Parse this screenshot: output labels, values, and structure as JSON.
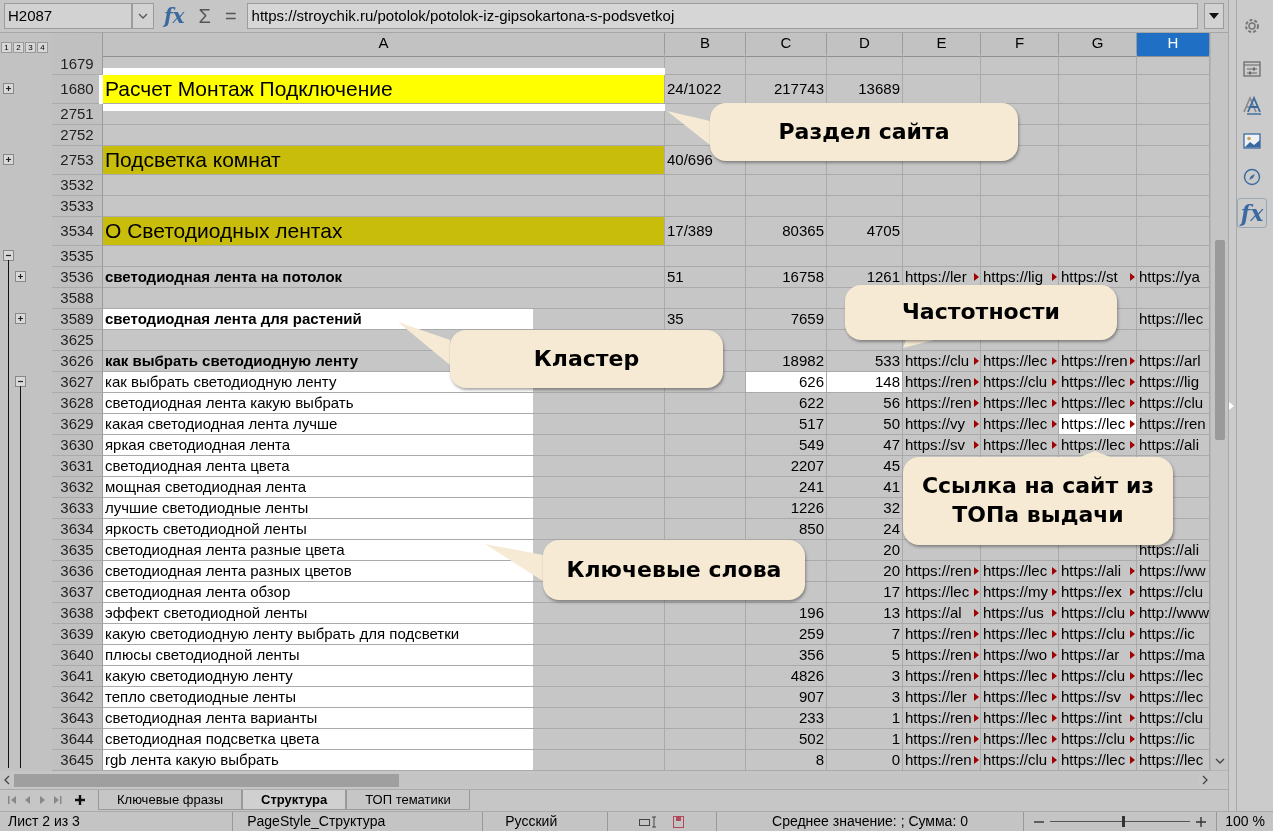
{
  "formula_bar": {
    "cell_ref": "H2087",
    "buttons": [
      {
        "kind": "function",
        "label": "fx"
      },
      {
        "kind": "sum",
        "label": "Σ"
      },
      {
        "kind": "formula",
        "label": "="
      }
    ],
    "content": "https://stroychik.ru/potolok/potolok-iz-gipsokartona-s-podsvetkoj"
  },
  "outline_levels": [
    "1",
    "2",
    "3",
    "4"
  ],
  "columns": [
    {
      "label": "A",
      "selected": false
    },
    {
      "label": "B",
      "selected": false
    },
    {
      "label": "C",
      "selected": false
    },
    {
      "label": "D",
      "selected": false
    },
    {
      "label": "E",
      "selected": false
    },
    {
      "label": "F",
      "selected": false
    },
    {
      "label": "G",
      "selected": false
    },
    {
      "label": "H",
      "selected": true
    }
  ],
  "rows": [
    {
      "number": "1679",
      "kind": "blank"
    },
    {
      "number": "1680",
      "kind": "section",
      "color": "#ffff00",
      "a": "Расчет Монтаж Подключение",
      "b": "24/1022",
      "c": "217743",
      "d": "13689",
      "a_highlighted": true,
      "outline": {
        "expanded": false,
        "nested": false
      }
    },
    {
      "number": "2751",
      "kind": "blank"
    },
    {
      "number": "2752",
      "kind": "blank"
    },
    {
      "number": "2753",
      "kind": "section",
      "color": "#c9bd0b",
      "a": "Подсветка комнат",
      "b": "40/696",
      "outline": {
        "expanded": false,
        "nested": false
      }
    },
    {
      "number": "3532",
      "kind": "blank"
    },
    {
      "number": "3533",
      "kind": "blank"
    },
    {
      "number": "3534",
      "kind": "section",
      "color": "#c9bd0b",
      "a": "О Светодиодных лентах",
      "b": "17/389",
      "c": "80365",
      "d": "4705"
    },
    {
      "number": "3535",
      "kind": "blank",
      "outline": {
        "expanded": true,
        "nested": false
      }
    },
    {
      "number": "3536",
      "kind": "cluster",
      "a": "светодиодная лента на потолок",
      "b": "51",
      "c": "16758",
      "d": "1261",
      "e": "https://ler",
      "f": "https://lig",
      "g": "https://st",
      "h": "https://ya",
      "outline": {
        "expanded": false,
        "nested": true
      }
    },
    {
      "number": "3588",
      "kind": "blank"
    },
    {
      "number": "3589",
      "kind": "cluster",
      "a": "светодиодная лента для растений",
      "b": "35",
      "c": "7659",
      "h": "https://lec",
      "a_highlighted": true,
      "outline": {
        "expanded": false,
        "nested": true
      }
    },
    {
      "number": "3625",
      "kind": "blank"
    },
    {
      "number": "3626",
      "kind": "cluster",
      "a": "как выбрать светодиодную ленту",
      "c": "18982",
      "d": "533",
      "e": "https://clu",
      "f": "https://lec",
      "g": "https://ren",
      "h": "https://arl"
    },
    {
      "number": "3627",
      "kind": "keyword",
      "a": "как выбрать светодиодную ленту",
      "c": "626",
      "d": "148",
      "e": "https://ren",
      "f": "https://clu",
      "g": "https://lec",
      "h": "https://lig",
      "a_highlighted": true,
      "c_highlighted": true,
      "d_highlighted": true,
      "outline": {
        "expanded": true,
        "nested": true
      }
    },
    {
      "number": "3628",
      "kind": "keyword",
      "a": "светодиодная лента какую выбрать",
      "c": "622",
      "d": "56",
      "e": "https://ren",
      "f": "https://lec",
      "g": "https://lec",
      "h": "https://clu",
      "a_highlighted": true
    },
    {
      "number": "3629",
      "kind": "keyword",
      "a": "какая светодиодная лента лучше",
      "c": "517",
      "d": "50",
      "e": "https://vy",
      "f": "https://lec",
      "g": "https://lec",
      "h": "https://ren",
      "a_highlighted": true,
      "g_highlighted": true
    },
    {
      "number": "3630",
      "kind": "keyword",
      "a": "яркая светодиодная лента",
      "c": "549",
      "d": "47",
      "e": "https://sv",
      "f": "https://lec",
      "g": "https://lec",
      "h": "https://ali",
      "a_highlighted": true
    },
    {
      "number": "3631",
      "kind": "keyword",
      "a": "светодиодная лента цвета",
      "c": "2207",
      "d": "45",
      "a_highlighted": true
    },
    {
      "number": "3632",
      "kind": "keyword",
      "a": "мощная светодиодная лента",
      "c": "241",
      "d": "41",
      "a_highlighted": true
    },
    {
      "number": "3633",
      "kind": "keyword",
      "a": "лучшие светодиодные ленты",
      "c": "1226",
      "d": "32",
      "a_highlighted": true
    },
    {
      "number": "3634",
      "kind": "keyword",
      "a": "яркость светодиодной ленты",
      "c": "850",
      "d": "24",
      "a_highlighted": true
    },
    {
      "number": "3635",
      "kind": "keyword",
      "a": "светодиодная лента разные цвета",
      "d": "20",
      "h": "https://ali",
      "a_highlighted": true
    },
    {
      "number": "3636",
      "kind": "keyword",
      "a": "светодиодная лента разных цветов",
      "d": "20",
      "e": "https://ren",
      "f": "https://lec",
      "g": "https://ali",
      "h": "https://ww",
      "a_highlighted": true
    },
    {
      "number": "3637",
      "kind": "keyword",
      "a": "светодиодная лента обзор",
      "d": "17",
      "e": "https://lec",
      "f": "https://my",
      "g": "https://ex",
      "h": "https://clu",
      "a_highlighted": true
    },
    {
      "number": "3638",
      "kind": "keyword",
      "a": "эффект светодиодной ленты",
      "c": "196",
      "d": "13",
      "e": "https://al",
      "f": "https://us",
      "g": "https://clu",
      "h": "http://www",
      "a_highlighted": true
    },
    {
      "number": "3639",
      "kind": "keyword",
      "a": "какую светодиодную ленту выбрать для подсветки",
      "c": "259",
      "d": "7",
      "e": "https://ren",
      "f": "https://lec",
      "g": "https://clu",
      "h": "https://ic",
      "a_highlighted": true
    },
    {
      "number": "3640",
      "kind": "keyword",
      "a": "плюсы светодиодной ленты",
      "c": "356",
      "d": "5",
      "e": "https://ren",
      "f": "https://wo",
      "g": "https://ar",
      "h": "https://ma",
      "a_highlighted": true
    },
    {
      "number": "3641",
      "kind": "keyword",
      "a": "какую светодиодную ленту",
      "c": "4826",
      "d": "3",
      "e": "https://ren",
      "f": "https://lec",
      "g": "https://clu",
      "h": "https://lec",
      "a_highlighted": true
    },
    {
      "number": "3642",
      "kind": "keyword",
      "a": "тепло светодиодные ленты",
      "c": "907",
      "d": "3",
      "e": "https://ler",
      "f": "https://lec",
      "g": "https://sv",
      "h": "https://lec",
      "a_highlighted": true
    },
    {
      "number": "3643",
      "kind": "keyword",
      "a": "светодиодная лента варианты",
      "c": "233",
      "d": "1",
      "e": "https://ren",
      "f": "https://lec",
      "g": "https://int",
      "h": "https://clu",
      "a_highlighted": true
    },
    {
      "number": "3644",
      "kind": "keyword",
      "a": "светодиодная подсветка цвета",
      "c": "502",
      "d": "1",
      "e": "https://ren",
      "f": "https://lec",
      "g": "https://clu",
      "h": "https://ic",
      "a_highlighted": true
    },
    {
      "number": "3645",
      "kind": "keyword",
      "a": "rgb лента какую выбрать",
      "c": "8",
      "d": "0",
      "e": "https://ren",
      "f": "https://clu",
      "g": "https://lec",
      "h": "https://lec",
      "a_highlighted": true
    }
  ],
  "callouts": [
    {
      "text": "Раздел сайта"
    },
    {
      "text": "Частотности"
    },
    {
      "text": "Кластер"
    },
    {
      "text": "Ссылка на сайт из ТОПа выдачи"
    },
    {
      "text": "Ключевые слова"
    }
  ],
  "sheet_tabs": [
    {
      "label": "Ключевые фразы",
      "selected": false
    },
    {
      "label": "Структура",
      "selected": true
    },
    {
      "label": "ТОП тематики",
      "selected": false
    }
  ],
  "sidebar": {
    "buttons": [
      {
        "kind": "settings"
      },
      {
        "kind": "properties"
      },
      {
        "kind": "styles"
      },
      {
        "kind": "gallery"
      },
      {
        "kind": "navigator"
      },
      {
        "kind": "functions",
        "label": "fx"
      }
    ]
  },
  "status_bar": {
    "sheet": "Лист 2 из 3",
    "page_style": "PageStyle_Структура",
    "language": "Русский",
    "summary": "Среднее значение: ; Сумма: 0",
    "zoom": {
      "level": 0.52
    },
    "zoom_label": "100 %"
  }
}
